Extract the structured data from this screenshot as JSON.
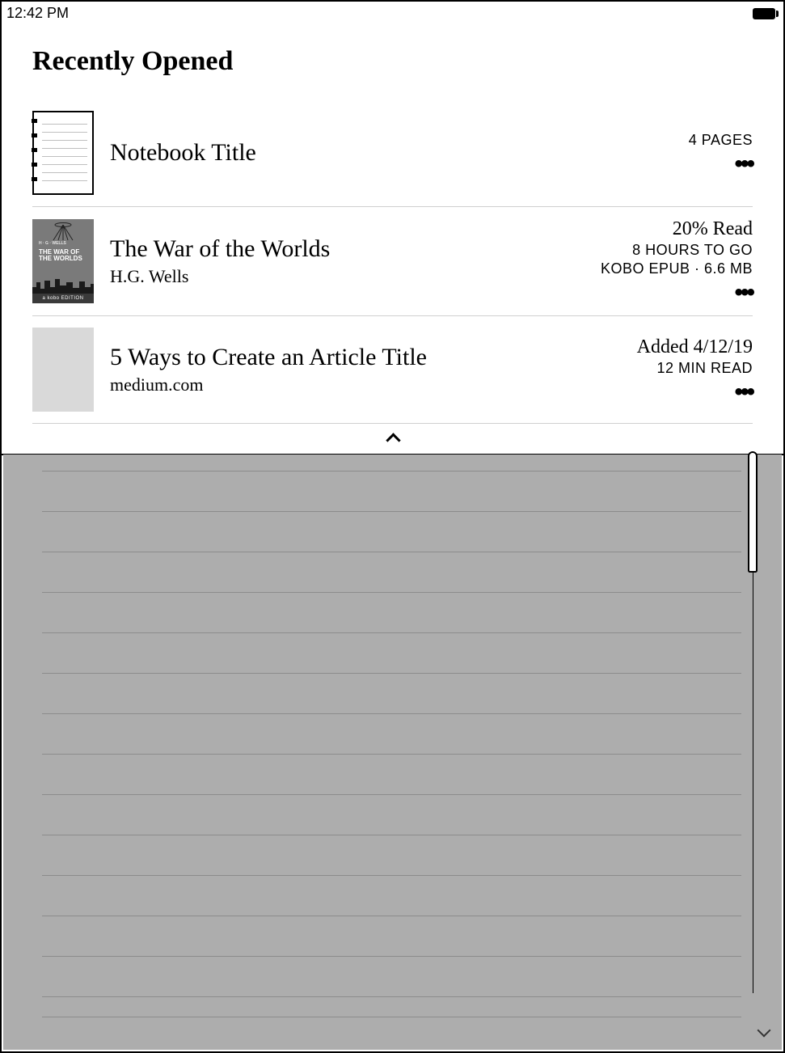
{
  "status": {
    "time": "12:42 PM"
  },
  "section_title": "Recently Opened",
  "items": [
    {
      "title": "Notebook Title",
      "subtitle": "",
      "meta_big": "",
      "meta1": "4 PAGES",
      "meta2": ""
    },
    {
      "title": "The War of the Worlds",
      "subtitle": "H.G. Wells",
      "meta_big": "20% Read",
      "meta1": "8 HOURS TO GO",
      "meta2": "KOBO EPUB · 6.6 MB",
      "cover_author": "H · G · WELLS",
      "cover_title": "THE WAR OF THE WORLDS",
      "cover_edition": "a kobo EDITION"
    },
    {
      "title": "5 Ways to Create an Article Title",
      "subtitle": "medium.com",
      "meta_big": "Added 4/12/19",
      "meta1": "12 MIN READ",
      "meta2": ""
    }
  ]
}
